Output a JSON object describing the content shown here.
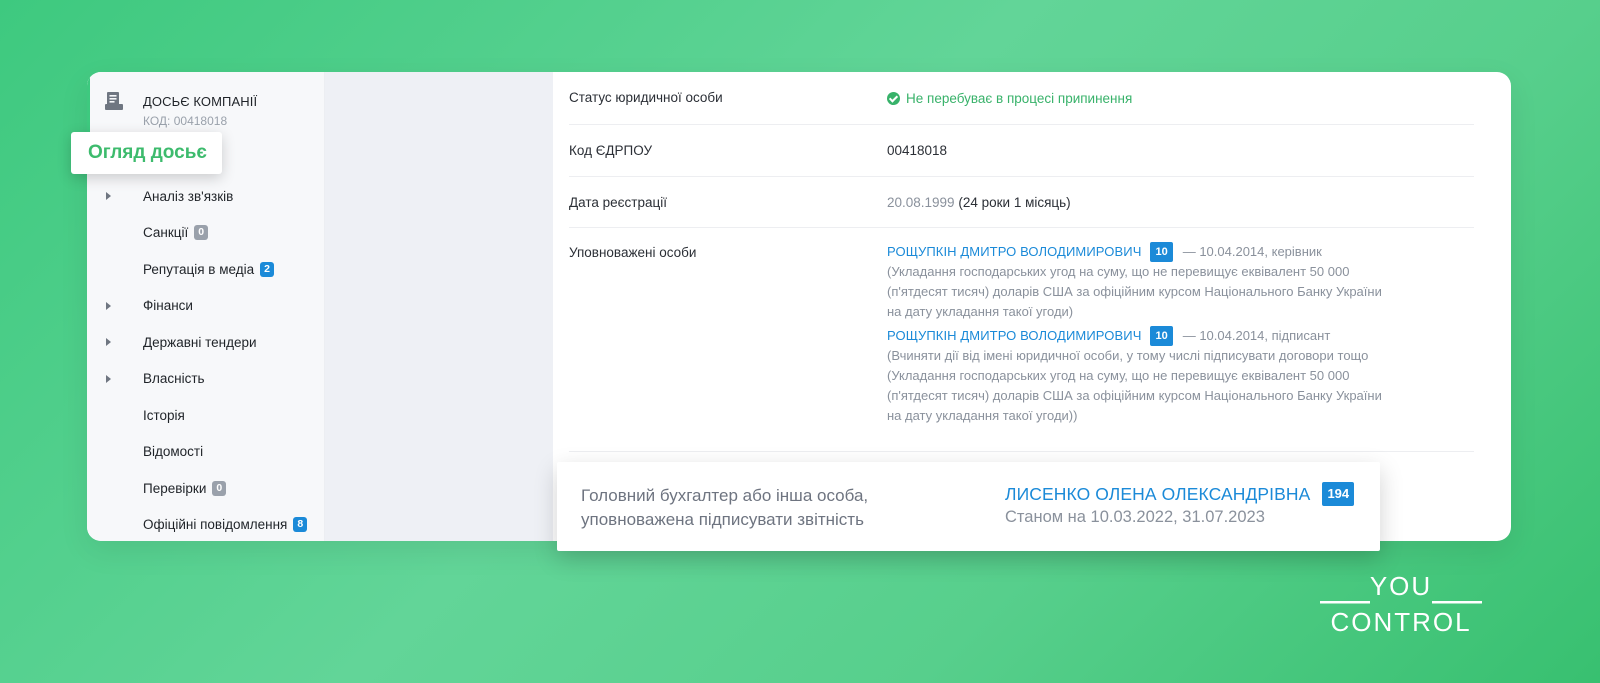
{
  "colors": {
    "accent": "#3ec97f",
    "link": "#1b8ad8",
    "ok": "#38b26a"
  },
  "company": {
    "icon": "document-icon",
    "title": "ДОСЬЄ КОМПАНІЇ",
    "code": "КОД: 00418018"
  },
  "active_item": "Огляд досьє",
  "nav": [
    {
      "label": "Аналіз зв'язків",
      "arrow": true
    },
    {
      "label": "Санкції",
      "badge": "0",
      "badge_color": "grey"
    },
    {
      "label": "Репутація в медіа",
      "badge": "2",
      "badge_color": "blue"
    },
    {
      "label": "Фінанси",
      "arrow": true
    },
    {
      "label": "Державні тендери",
      "arrow": true
    },
    {
      "label": "Власність",
      "arrow": true
    },
    {
      "label": "Історія"
    },
    {
      "label": "Відомості"
    },
    {
      "label": "Перевірки",
      "badge": "0",
      "badge_color": "grey"
    },
    {
      "label": "Офіційні повідомлення",
      "badge": "8",
      "badge_color": "blue"
    }
  ],
  "details": {
    "status": {
      "label": "Статус юридичної особи",
      "value": "Не перебуває в процесі припинення"
    },
    "edrpou": {
      "label": "Код ЄДРПОУ",
      "value": "00418018"
    },
    "registration": {
      "label": "Дата реєстрації",
      "date": "20.08.1999",
      "age": "(24 роки 1 місяць)"
    },
    "authorized": {
      "label": "Уповноважені особи",
      "persons": [
        {
          "name": "РОЩУПКІН ДМИТРО ВОЛОДИМИРОВИЧ",
          "badge": "10",
          "role": "— 10.04.2014, керівник",
          "note": "(Укладання господарських угод на суму, що не перевищує еквівалент 50 000 (п'ятдесят тисяч) доларів США за офіційним курсом Національного Банку України на дату укладання такої угоди)"
        },
        {
          "name": "РОЩУПКІН ДМИТРО ВОЛОДИМИРОВИЧ",
          "badge": "10",
          "role": "— 10.04.2014, підписант",
          "note": "(Вчиняти дії від імені юридичної особи, у тому числі підписувати договори тощо (Укладання господарських угод на суму, що не перевищує еквівалент 50 000 (п'ятдесят тисяч) доларів США за офіційним курсом Національного Банку України на дату укладання такої угоди))"
        }
      ]
    }
  },
  "popup": {
    "label": "Головний бухгалтер або інша особа, уповноважена підписувати звітність",
    "name": "ЛИСЕНКО ОЛЕНА ОЛЕКСАНДРІВНА",
    "badge": "194",
    "date": "Станом на 10.03.2022, 31.07.2023"
  },
  "logo": {
    "line1": "YOU",
    "line2": "CONTROL"
  }
}
